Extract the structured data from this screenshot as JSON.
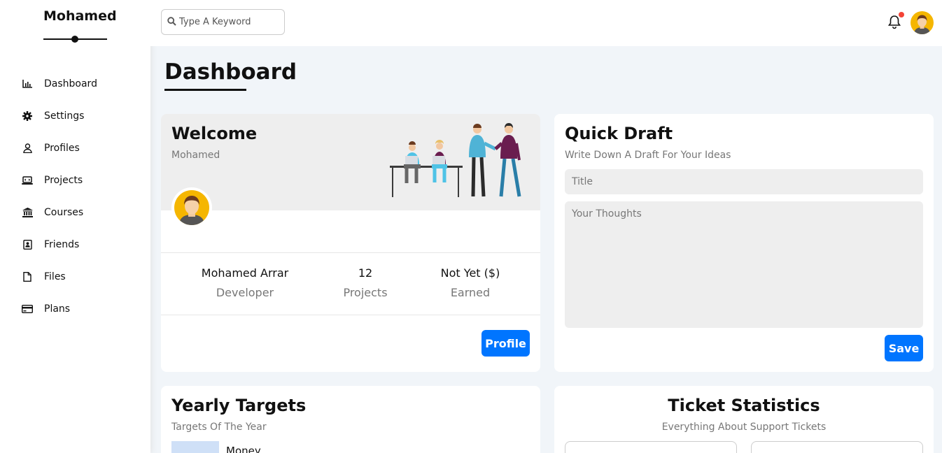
{
  "sidebar": {
    "brand": "Mohamed",
    "items": [
      {
        "label": "Dashboard",
        "icon": "bar-chart-icon"
      },
      {
        "label": "Settings",
        "icon": "gear-icon"
      },
      {
        "label": "Profiles",
        "icon": "user-icon"
      },
      {
        "label": "Projects",
        "icon": "laptop-icon"
      },
      {
        "label": "Courses",
        "icon": "bank-icon"
      },
      {
        "label": "Friends",
        "icon": "address-book-icon"
      },
      {
        "label": "Files",
        "icon": "file-icon"
      },
      {
        "label": "Plans",
        "icon": "credit-card-icon"
      }
    ]
  },
  "header": {
    "search_placeholder": "Type A Keyword",
    "notification_color": "#f44336"
  },
  "page": {
    "title": "Dashboard"
  },
  "welcome": {
    "title": "Welcome",
    "subtitle": "Mohamed",
    "stats": [
      {
        "value": "Mohamed Arrar",
        "label": "Developer"
      },
      {
        "value": "12",
        "label": "Projects"
      },
      {
        "value": "Not Yet ($)",
        "label": "Earned"
      }
    ],
    "button": "Profile"
  },
  "draft": {
    "title": "Quick Draft",
    "subtitle": "Write Down A Draft For Your Ideas",
    "title_placeholder": "Title",
    "body_placeholder": "Your Thoughts",
    "button": "Save"
  },
  "yearly": {
    "title": "Yearly Targets",
    "subtitle": "Targets Of The Year",
    "first_target": "Money"
  },
  "tickets": {
    "title": "Ticket Statistics",
    "subtitle": "Everything About Support Tickets"
  },
  "colors": {
    "accent": "#0075ff",
    "background": "#f1f5f9",
    "avatar": "#f5b600"
  }
}
